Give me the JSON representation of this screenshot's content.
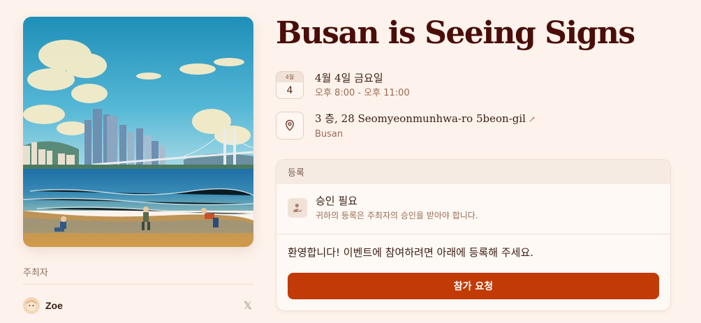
{
  "event": {
    "title": "Busan is Seeing Signs"
  },
  "date": {
    "month_badge": "4월",
    "day_badge": "4",
    "full_date": "4월 4일 금요일",
    "time_range": "오후 8:00 - 오후 11:00"
  },
  "location": {
    "address": "3 층, 28 Seomyeonmunhwa-ro 5beon-gil",
    "city": "Busan",
    "icon": "map-pin-icon",
    "link_icon": "external-arrow-icon"
  },
  "hosts": {
    "label": "주최자",
    "items": [
      {
        "name": "Zoe",
        "social_icon": "x-icon",
        "social_glyph": "𝕏"
      }
    ]
  },
  "registration": {
    "header": "등록",
    "approval_title": "승인 필요",
    "approval_desc": "귀하의 등록은 주최자의 승인을 받아야 합니다.",
    "welcome": "환영합니다! 이벤트에 참여하려면 아래에 등록해 주세요.",
    "button_label": "참가 요청"
  },
  "colors": {
    "background": "#fdf3ec",
    "title": "#4a0d08",
    "accent_button": "#c23a05"
  }
}
